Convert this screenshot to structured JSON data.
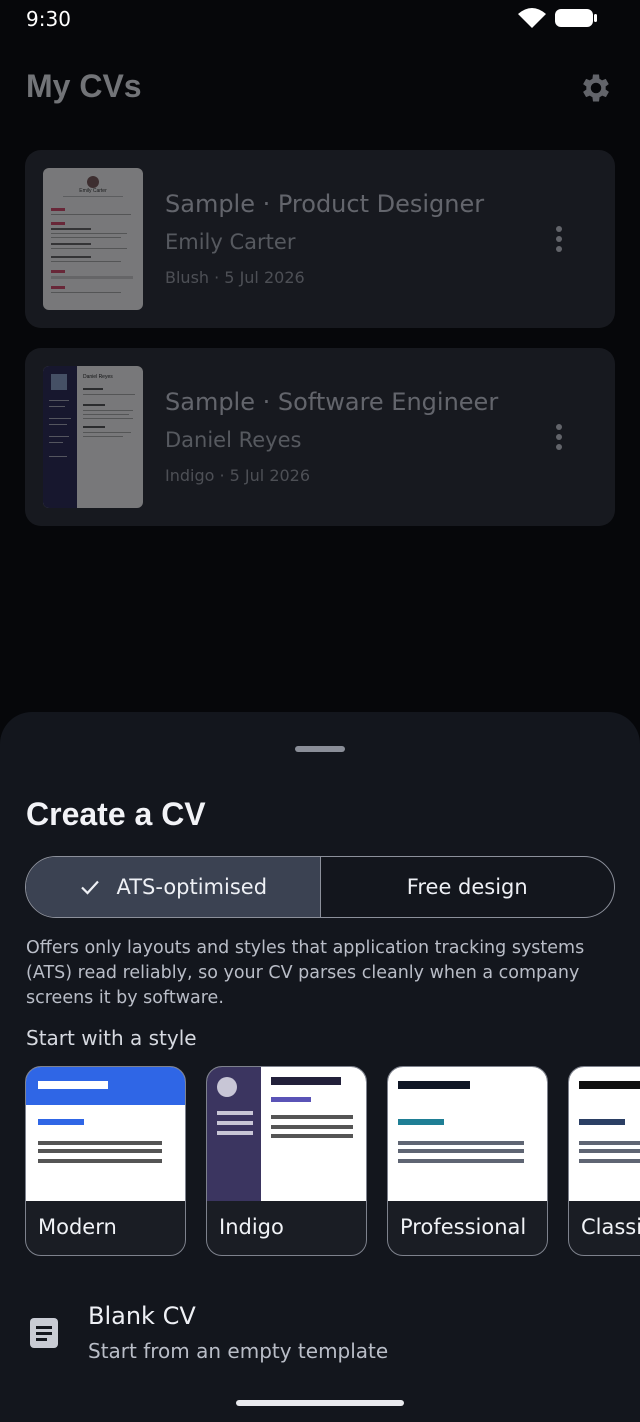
{
  "status_bar": {
    "time": "9:30"
  },
  "header": {
    "title": "My CVs",
    "settings_icon": "gear-icon"
  },
  "cv_list": [
    {
      "title": "Sample · Product Designer",
      "name": "Emily Carter",
      "meta": "Blush · 5 Jul 2026",
      "thumbnail_name": "Emily Carter"
    },
    {
      "title": "Sample · Software Engineer",
      "name": "Daniel Reyes",
      "meta": "Indigo · 5 Jul 2026",
      "thumbnail_name": "Daniel Reyes"
    }
  ],
  "sheet": {
    "title": "Create a CV",
    "modes": [
      {
        "label": "ATS-optimised",
        "selected": true
      },
      {
        "label": "Free design",
        "selected": false
      }
    ],
    "helper_text": "Offers only layouts and styles that application tracking systems (ATS) read reliably, so your CV parses cleanly when a company screens it by software.",
    "styles_label": "Start with a style",
    "styles": [
      {
        "label": "Modern",
        "accent": "#2f66e6"
      },
      {
        "label": "Indigo",
        "accent": "#3b3560"
      },
      {
        "label": "Professional",
        "accent": "#1f7f95"
      },
      {
        "label": "Classic",
        "accent": "#2b3f64"
      }
    ],
    "blank": {
      "title": "Blank CV",
      "subtitle": "Start from an empty template",
      "icon": "document-icon"
    }
  }
}
